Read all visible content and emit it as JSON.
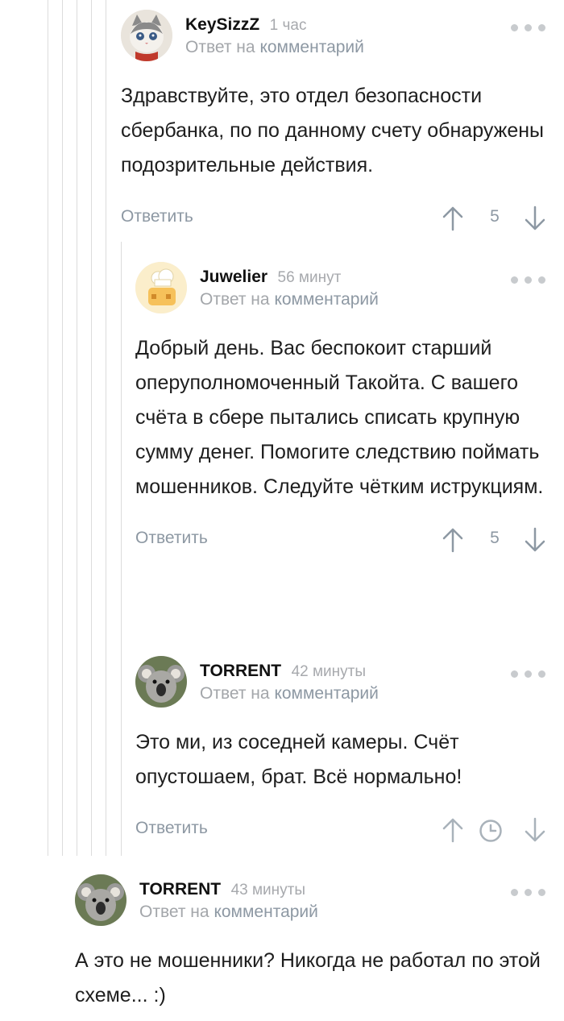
{
  "comments": [
    {
      "author": "KeySizzZ",
      "time": "1 час",
      "reply_prefix": "Ответ на",
      "reply_link": "комментарий",
      "text": "Здравствуйте, это отдел безопасности сбербанка, по по данному счету обнаружены подозрительные действия.",
      "reply_button": "Ответить",
      "rating": "5",
      "avatar": "cat-avatar-icon"
    },
    {
      "author": "Juwelier",
      "time": "56 минут",
      "reply_prefix": "Ответ на",
      "reply_link": "комментарий",
      "text": "Добрый день. Вас беспокоит старший оперуполномоченный Такойта. С вашего счёта в сбере пытались списать крупную сумму денег. Помогите следствию поймать мошенников. Следуйте чётким иструкциям.",
      "reply_button": "Ответить",
      "rating": "5",
      "avatar": "chef-avatar-icon"
    },
    {
      "author": "TORRENT",
      "time": "42 минуты",
      "reply_prefix": "Ответ на",
      "reply_link": "комментарий",
      "text": "Это ми, из соседней камеры. Счёт опустошаем, брат. Всё нормально!",
      "reply_button": "Ответить",
      "rating_icon": "clock-icon",
      "avatar": "koala-avatar-icon"
    },
    {
      "author": "TORRENT",
      "time": "43 минуты",
      "reply_prefix": "Ответ на",
      "reply_link": "комментарий",
      "text": "А это не мошенники? Никогда не работал по этой схеме... :)",
      "avatar": "koala-avatar-icon"
    }
  ],
  "colors": {
    "meta_gray": "#a7a9ad",
    "link_gray_blue": "#8d98a3",
    "thread_line": "#dcdcdc",
    "dots": "#c8cbce"
  }
}
